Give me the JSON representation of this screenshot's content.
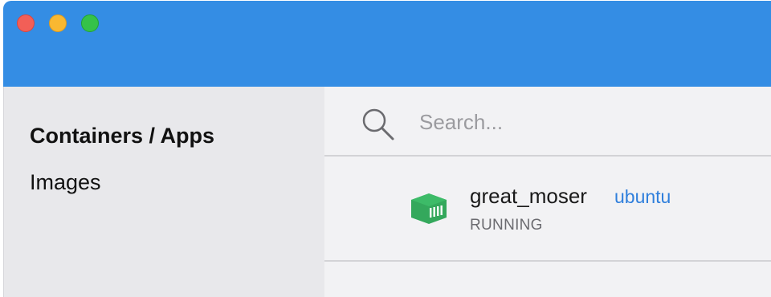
{
  "window": {
    "controls": [
      "close",
      "minimize",
      "zoom"
    ]
  },
  "sidebar": {
    "items": [
      {
        "label": "Containers / Apps",
        "active": true
      },
      {
        "label": "Images",
        "active": false
      }
    ]
  },
  "search": {
    "placeholder": "Search...",
    "value": "",
    "icon": "search-icon"
  },
  "containers": [
    {
      "name": "great_moser",
      "image": "ubuntu",
      "status": "RUNNING",
      "icon": "container-icon",
      "icon_color": "#34a85c"
    }
  ],
  "colors": {
    "titlebar": "#348de4",
    "link": "#2f7fdc",
    "running_icon": "#34a85c"
  }
}
